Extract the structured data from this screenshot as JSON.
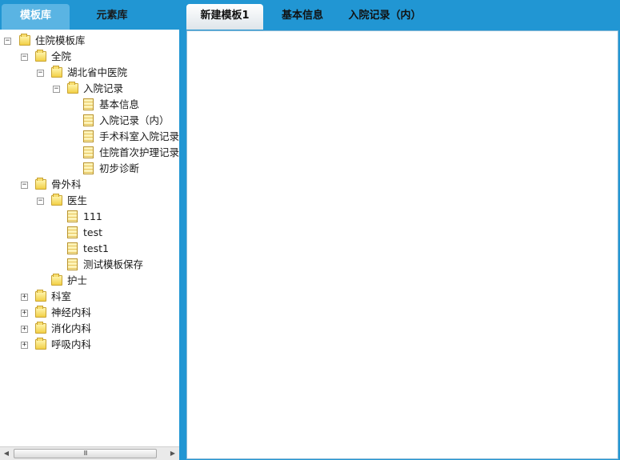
{
  "left_tabs": {
    "template_lib": "模板库",
    "element_lib": "元素库"
  },
  "tree": {
    "root": "住院模板库",
    "quanyuan": "全院",
    "hubei": "湖北省中医院",
    "ruyuan": "入院记录",
    "ruyuan_children": [
      "基本信息",
      "入院记录（内）",
      "手术科室入院记录",
      "住院首次护理记录",
      "初步诊断"
    ],
    "guwaike": "骨外科",
    "yisheng": "医生",
    "yisheng_children": [
      "111",
      "test",
      "test1",
      "测试模板保存"
    ],
    "hushi": "护士",
    "keshi": "科室",
    "shenjing": "神经内科",
    "xiaohua": "消化内科",
    "huxi": "呼吸内科",
    "toggle_expanded": "−",
    "toggle_collapsed": "+"
  },
  "scrollbar": {
    "left_arrow": "◀",
    "right_arrow": "▶",
    "grip": "III"
  },
  "right_tabs": [
    "新建模板1",
    "基本信息",
    "入院记录（内）"
  ],
  "icons": {
    "folder": "folder-icon",
    "document": "document-icon"
  },
  "colors": {
    "frame_blue": "#2196d3",
    "active_left_tab": "#5ab4e3"
  }
}
